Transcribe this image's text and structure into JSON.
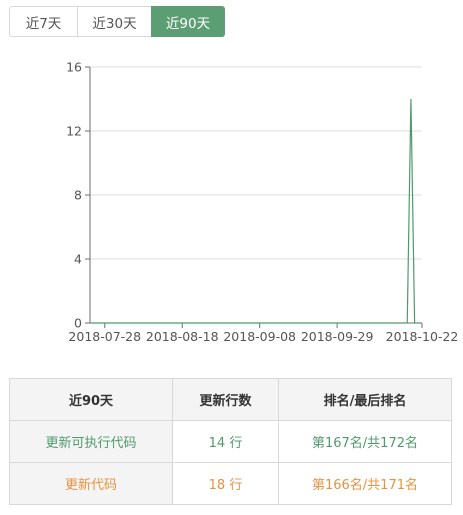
{
  "tabs": [
    {
      "label": "近7天",
      "active": false
    },
    {
      "label": "近30天",
      "active": false
    },
    {
      "label": "近90天",
      "active": true
    }
  ],
  "colors": {
    "accent": "#5c9e73",
    "line": "#4f9a6c",
    "orange": "#e9923e"
  },
  "chart_data": {
    "type": "line",
    "x": [
      "2018-07-24",
      "2018-07-25",
      "2018-07-26",
      "2018-07-27",
      "2018-07-28",
      "2018-07-29",
      "2018-07-30",
      "2018-07-31",
      "2018-08-01",
      "2018-08-02",
      "2018-08-03",
      "2018-08-04",
      "2018-08-05",
      "2018-08-06",
      "2018-08-07",
      "2018-08-08",
      "2018-08-09",
      "2018-08-10",
      "2018-08-11",
      "2018-08-12",
      "2018-08-13",
      "2018-08-14",
      "2018-08-15",
      "2018-08-16",
      "2018-08-17",
      "2018-08-18",
      "2018-08-19",
      "2018-08-20",
      "2018-08-21",
      "2018-08-22",
      "2018-08-23",
      "2018-08-24",
      "2018-08-25",
      "2018-08-26",
      "2018-08-27",
      "2018-08-28",
      "2018-08-29",
      "2018-08-30",
      "2018-08-31",
      "2018-09-01",
      "2018-09-02",
      "2018-09-03",
      "2018-09-04",
      "2018-09-05",
      "2018-09-06",
      "2018-09-07",
      "2018-09-08",
      "2018-09-09",
      "2018-09-10",
      "2018-09-11",
      "2018-09-12",
      "2018-09-13",
      "2018-09-14",
      "2018-09-15",
      "2018-09-16",
      "2018-09-17",
      "2018-09-18",
      "2018-09-19",
      "2018-09-20",
      "2018-09-21",
      "2018-09-22",
      "2018-09-23",
      "2018-09-24",
      "2018-09-25",
      "2018-09-26",
      "2018-09-27",
      "2018-09-28",
      "2018-09-29",
      "2018-09-30",
      "2018-10-01",
      "2018-10-02",
      "2018-10-03",
      "2018-10-04",
      "2018-10-05",
      "2018-10-06",
      "2018-10-07",
      "2018-10-08",
      "2018-10-09",
      "2018-10-10",
      "2018-10-11",
      "2018-10-12",
      "2018-10-13",
      "2018-10-14",
      "2018-10-15",
      "2018-10-16",
      "2018-10-17",
      "2018-10-18",
      "2018-10-19",
      "2018-10-20",
      "2018-10-21",
      "2018-10-22"
    ],
    "series": [
      {
        "values": [
          0,
          0,
          0,
          0,
          0,
          0,
          0,
          0,
          0,
          0,
          0,
          0,
          0,
          0,
          0,
          0,
          0,
          0,
          0,
          0,
          0,
          0,
          0,
          0,
          0,
          0,
          0,
          0,
          0,
          0,
          0,
          0,
          0,
          0,
          0,
          0,
          0,
          0,
          0,
          0,
          0,
          0,
          0,
          0,
          0,
          0,
          0,
          0,
          0,
          0,
          0,
          0,
          0,
          0,
          0,
          0,
          0,
          0,
          0,
          0,
          0,
          0,
          0,
          0,
          0,
          0,
          0,
          0,
          0,
          0,
          0,
          0,
          0,
          0,
          0,
          0,
          0,
          0,
          0,
          0,
          0,
          0,
          0,
          0,
          0,
          0,
          0,
          14,
          0,
          0,
          0
        ]
      }
    ],
    "xticks": [
      "2018-07-28",
      "2018-08-18",
      "2018-09-08",
      "2018-09-29",
      "2018-10-22"
    ],
    "yticks": [
      0,
      4,
      8,
      12,
      16
    ],
    "ylim": [
      0,
      16
    ],
    "grid": "horizontal"
  },
  "table": {
    "headers": [
      "近90天",
      "更新行数",
      "排名/最后排名"
    ],
    "rows": [
      {
        "label": "更新可执行代码",
        "lines": "14 行",
        "rank": "第167名/共172名",
        "color": "green"
      },
      {
        "label": "更新代码",
        "lines": "18 行",
        "rank": "第166名/共171名",
        "color": "orange"
      }
    ]
  }
}
